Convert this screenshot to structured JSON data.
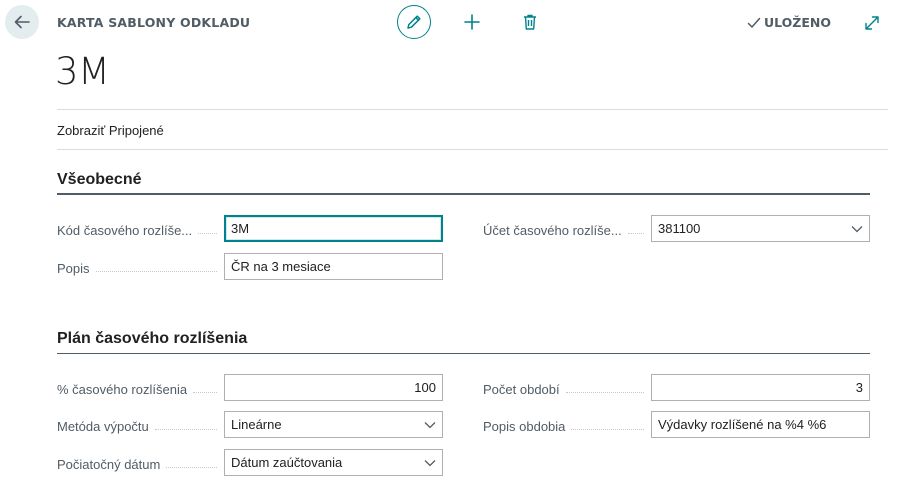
{
  "header": {
    "caption": "KARTA SABLONY ODKLADU",
    "saved_label": "ULOŽENO",
    "icons": [
      "back-arrow-icon",
      "pencil-icon",
      "plus-icon",
      "trash-icon",
      "checkmark-icon",
      "expand-icon"
    ]
  },
  "record": {
    "title": "3M"
  },
  "actions": {
    "show_attached": "Zobraziť Pripojené"
  },
  "general": {
    "title": "Všeobecné",
    "code_label": "Kód časového rozlíše...",
    "code_value": "3M",
    "description_label": "Popis",
    "description_value": "ČR na 3 mesiace",
    "account_label": "Účet časového rozlíše...",
    "account_value": "381100"
  },
  "schedule": {
    "title": "Plán časového rozlíšenia",
    "percent_label": "% časového rozlíšenia",
    "percent_value": "100",
    "method_label": "Metóda výpočtu",
    "method_value": "Lineárne",
    "start_date_label": "Počiatočný dátum",
    "start_date_value": "Dátum zaúčtovania",
    "periods_label": "Počet období",
    "periods_value": "3",
    "period_desc_label": "Popis obdobia",
    "period_desc_value": "Výdavky rozlíšené na %4 %6"
  },
  "colors": {
    "accent": "#00838c",
    "header_text": "#505c66",
    "back_bg": "#e3ecef"
  }
}
